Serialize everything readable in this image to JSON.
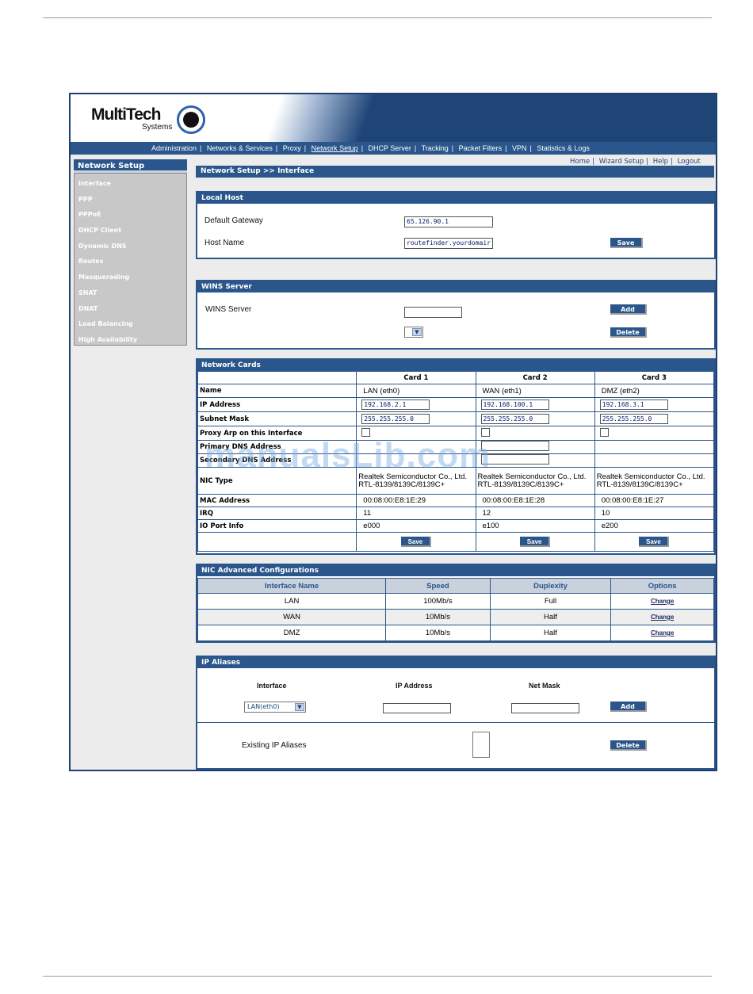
{
  "brand": {
    "logo_text": "MultiTech",
    "logo_sub": "Systems"
  },
  "topnav": [
    {
      "label": "Administration",
      "active": false
    },
    {
      "label": "Networks & Services",
      "active": false
    },
    {
      "label": "Proxy",
      "active": false
    },
    {
      "label": "Network Setup",
      "active": true
    },
    {
      "label": "DHCP Server",
      "active": false
    },
    {
      "label": "Tracking",
      "active": false
    },
    {
      "label": "Packet Filters",
      "active": false
    },
    {
      "label": "VPN",
      "active": false
    },
    {
      "label": "Statistics & Logs",
      "active": false
    }
  ],
  "toplinks": [
    "Home",
    "Wizard Setup",
    "Help",
    "Logout"
  ],
  "sidebar": {
    "title": "Network Setup",
    "items": [
      "Interface",
      "PPP",
      "PPPoE",
      "DHCP Client",
      "Dynamic DNS",
      "Routes",
      "Masquerading",
      "SNAT",
      "DNAT",
      "Load Balancing",
      "High Availability"
    ]
  },
  "breadcrumb": "Network Setup >> Interface",
  "local_host": {
    "title": "Local Host",
    "gateway_label": "Default Gateway",
    "gateway_value": "65.126.90.1",
    "hostname_label": "Host Name",
    "hostname_value": "routefinder.yourdomair",
    "save_label": "Save"
  },
  "wins": {
    "title": "WINS Server",
    "label": "WINS Server",
    "value": "",
    "add_label": "Add",
    "delete_label": "Delete"
  },
  "network_cards": {
    "title": "Network Cards",
    "columns": [
      "Card 1",
      "Card 2",
      "Card 3"
    ],
    "row_labels": {
      "name": "Name",
      "ip": "IP Address",
      "mask": "Subnet Mask",
      "proxy_arp": "Proxy Arp on this Interface",
      "primary_dns": "Primary DNS Address",
      "secondary_dns": "Secondary DNS Address",
      "nic": "NIC Type",
      "mac": "MAC Address",
      "irq": "IRQ",
      "io": "IO Port Info"
    },
    "cards": [
      {
        "name": "LAN (eth0)",
        "ip": "192.168.2.1",
        "mask": "255.255.255.0",
        "nic": "Realtek Semiconductor Co., Ltd. RTL-8139/8139C/8139C+",
        "mac": "00:08:00:E8:1E:29",
        "irq": "11",
        "io": "e000"
      },
      {
        "name": "WAN (eth1)",
        "ip": "192.168.100.1",
        "mask": "255.255.255.0",
        "nic": "Realtek Semiconductor Co., Ltd. RTL-8139/8139C/8139C+",
        "mac": "00:08:00:E8:1E:28",
        "irq": "12",
        "io": "e100"
      },
      {
        "name": "DMZ (eth2)",
        "ip": "192.168.3.1",
        "mask": "255.255.255.0",
        "nic": "Realtek Semiconductor Co., Ltd. RTL-8139/8139C/8139C+",
        "mac": "00:08:00:E8:1E:27",
        "irq": "10",
        "io": "e200"
      }
    ],
    "save_label": "Save"
  },
  "nic_advanced": {
    "title": "NIC Advanced Configurations",
    "headers": [
      "Interface Name",
      "Speed",
      "Duplexity",
      "Options"
    ],
    "rows": [
      {
        "iface": "LAN",
        "speed": "100Mb/s",
        "duplex": "Full",
        "option": "Change"
      },
      {
        "iface": "WAN",
        "speed": "10Mb/s",
        "duplex": "Half",
        "option": "Change"
      },
      {
        "iface": "DMZ",
        "speed": "10Mb/s",
        "duplex": "Half",
        "option": "Change"
      }
    ]
  },
  "ip_aliases": {
    "title": "IP Aliases",
    "interface_header": "Interface",
    "ip_header": "IP Address",
    "mask_header": "Net Mask",
    "interface_selected": "LAN(eth0)",
    "add_label": "Add",
    "existing_label": "Existing IP Aliases",
    "delete_label": "Delete"
  },
  "watermark": "manualsLib.com"
}
